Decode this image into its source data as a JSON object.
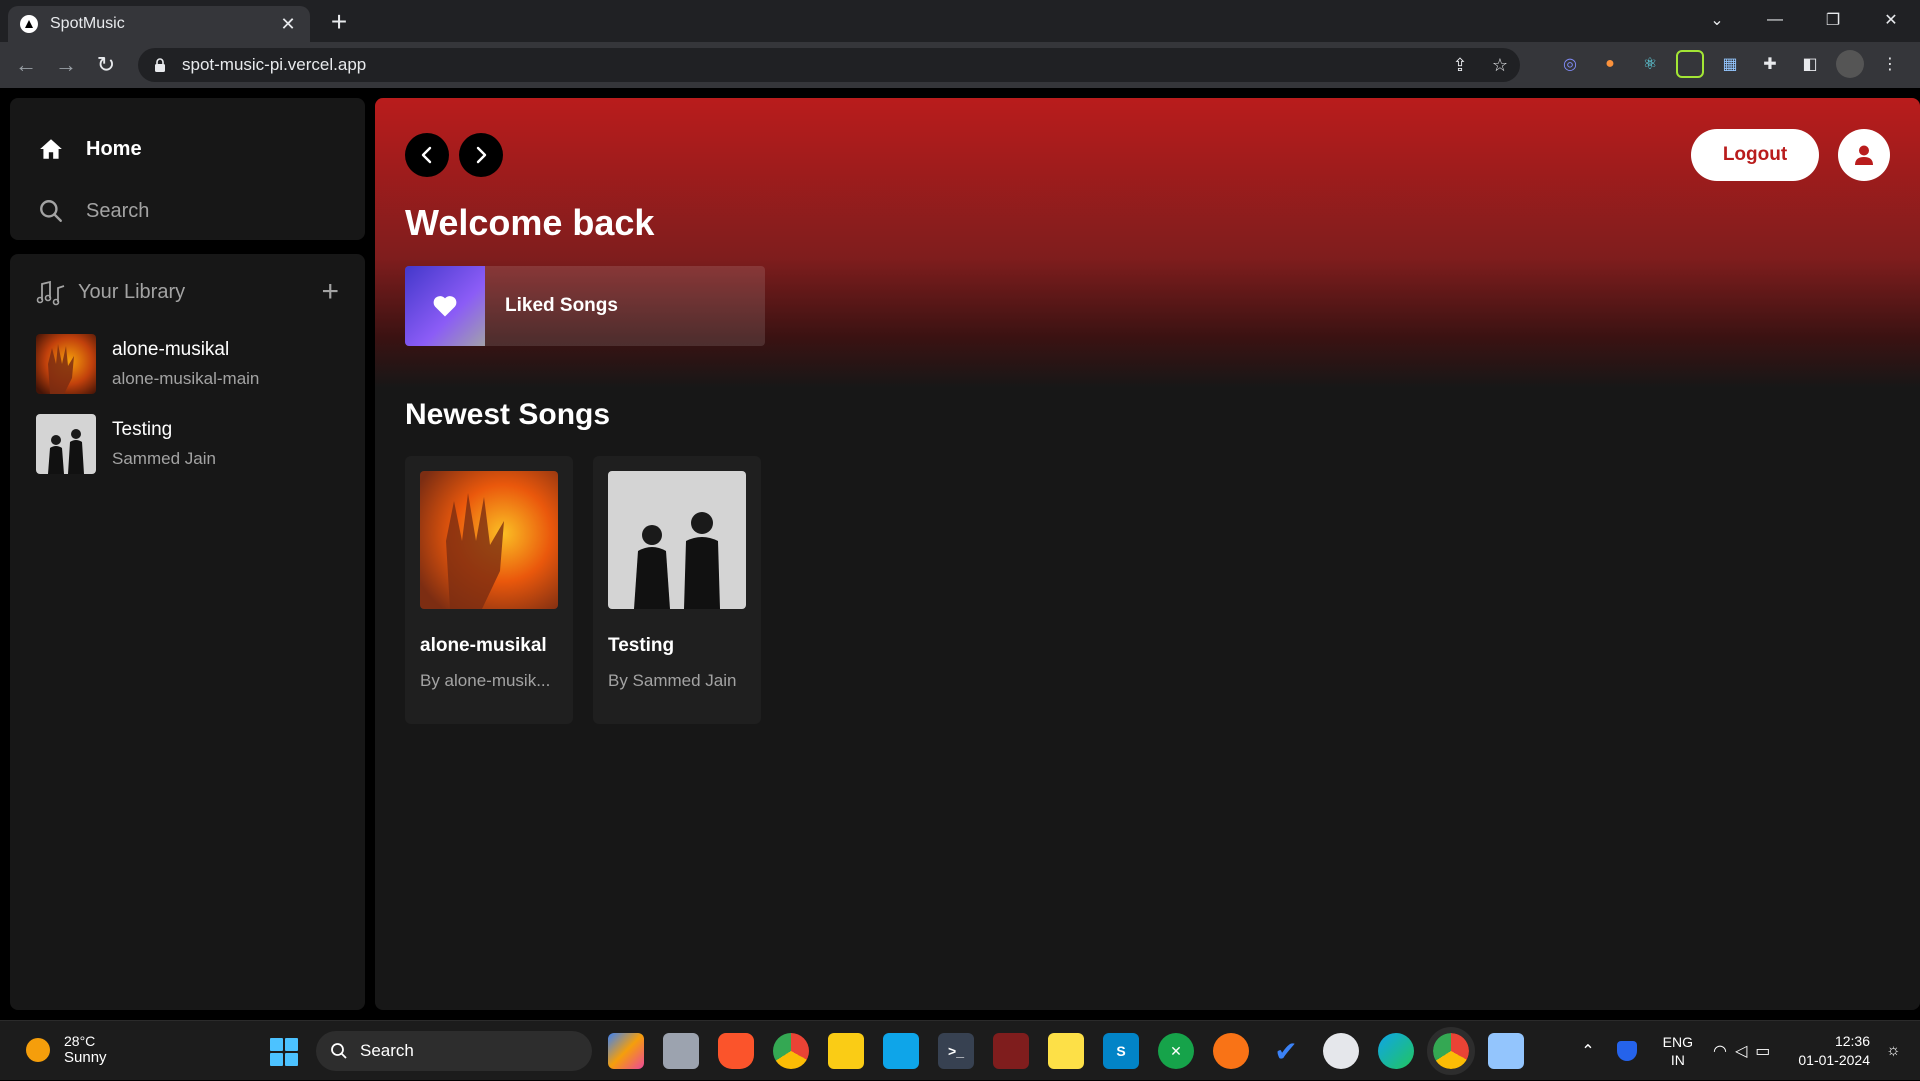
{
  "browser": {
    "tab_title": "SpotMusic",
    "url": "spot-music-pi.vercel.app",
    "new_tab": "+",
    "tab_close": "✕"
  },
  "sidebar": {
    "nav": [
      {
        "label": "Home",
        "icon": "home-icon"
      },
      {
        "label": "Search",
        "icon": "search-icon"
      }
    ],
    "library_title": "Your Library",
    "library_add": "+",
    "library_items": [
      {
        "title": "alone-musikal",
        "subtitle": "alone-musikal-main",
        "cover": "orange-hand-cover"
      },
      {
        "title": "Testing",
        "subtitle": "Sammed Jain",
        "cover": "bw-duo-cover"
      }
    ]
  },
  "main": {
    "logout_label": "Logout",
    "welcome": "Welcome back",
    "liked_songs": "Liked Songs",
    "newest_heading": "Newest Songs",
    "songs": [
      {
        "title": "alone-musikal",
        "author": "By alone-musik..."
      },
      {
        "title": "Testing",
        "author": "By Sammed Jain"
      }
    ],
    "accent_color": "#b91c1c"
  },
  "taskbar": {
    "temp": "28°C",
    "condition": "Sunny",
    "search": "Search",
    "lang_top": "ENG",
    "lang_bottom": "IN",
    "time": "12:36",
    "date": "01-01-2024"
  }
}
